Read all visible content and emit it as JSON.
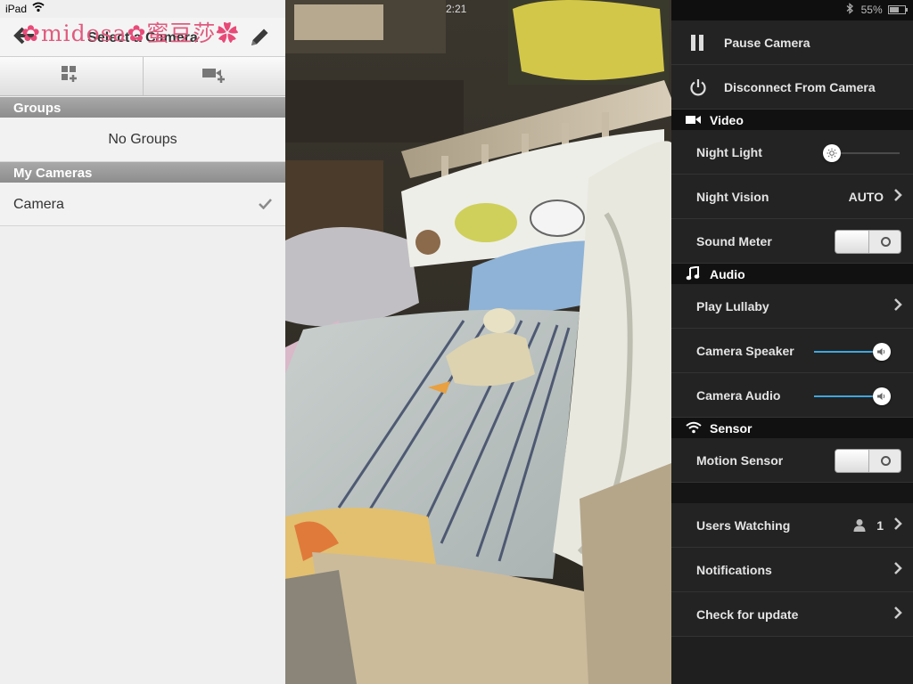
{
  "statusbar": {
    "device": "iPad",
    "time": "2:21",
    "battery": "55%"
  },
  "watermark": {
    "text": "midosa",
    "text_cjk": "蜜豆莎"
  },
  "left": {
    "title": "Select a Camera",
    "groups_header": "Groups",
    "no_groups": "No Groups",
    "cameras_header": "My Cameras",
    "cameras": [
      {
        "name": "Camera",
        "selected": true
      }
    ]
  },
  "right": {
    "pause": "Pause Camera",
    "disconnect": "Disconnect From Camera",
    "video_header": "Video",
    "night_light": "Night Light",
    "night_light_level": 0,
    "night_vision": "Night Vision",
    "night_vision_value": "AUTO",
    "sound_meter": "Sound Meter",
    "sound_meter_on": false,
    "audio_header": "Audio",
    "play_lullaby": "Play Lullaby",
    "camera_speaker": "Camera Speaker",
    "camera_speaker_level": 1.0,
    "camera_audio": "Camera Audio",
    "camera_audio_level": 1.0,
    "sensor_header": "Sensor",
    "motion_sensor": "Motion Sensor",
    "motion_sensor_on": false,
    "users_watching": "Users Watching",
    "users_count": "1",
    "notifications": "Notifications",
    "check_update": "Check for update"
  },
  "colors": {
    "accent": "#3ea7e0",
    "watermark": "#e05a7e"
  }
}
